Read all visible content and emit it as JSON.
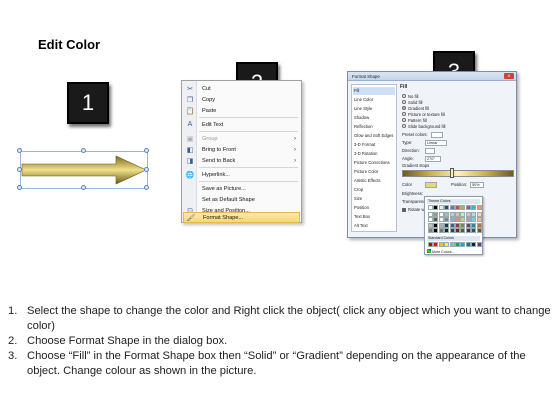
{
  "page": {
    "title": "Edit Color"
  },
  "badges": [
    "1",
    "2",
    "3"
  ],
  "context_menu": {
    "items": [
      {
        "label": "Cut",
        "icon": "scissors-icon",
        "disabled": false,
        "submenu": false,
        "highlight": false
      },
      {
        "label": "Copy",
        "icon": "copy-icon",
        "disabled": false,
        "submenu": false,
        "highlight": false
      },
      {
        "label": "Paste",
        "icon": "paste-icon",
        "disabled": false,
        "submenu": false,
        "highlight": false
      },
      {
        "label": "Edit Text",
        "icon": "edit-text-icon",
        "disabled": false,
        "submenu": false,
        "highlight": false
      },
      {
        "label": "Group",
        "icon": "group-icon",
        "disabled": true,
        "submenu": true,
        "highlight": false
      },
      {
        "label": "Bring to Front",
        "icon": "bring-front-icon",
        "disabled": false,
        "submenu": true,
        "highlight": false
      },
      {
        "label": "Send to Back",
        "icon": "send-back-icon",
        "disabled": false,
        "submenu": true,
        "highlight": false
      },
      {
        "label": "Hyperlink...",
        "icon": "hyperlink-icon",
        "disabled": false,
        "submenu": false,
        "highlight": false
      },
      {
        "label": "Save as Picture...",
        "icon": "",
        "disabled": false,
        "submenu": false,
        "highlight": false
      },
      {
        "label": "Set as Default Shape",
        "icon": "",
        "disabled": false,
        "submenu": false,
        "highlight": false
      },
      {
        "label": "Size and Position...",
        "icon": "size-position-icon",
        "disabled": false,
        "submenu": false,
        "highlight": false
      },
      {
        "label": "Format Shape...",
        "icon": "format-shape-icon",
        "disabled": false,
        "submenu": false,
        "highlight": true
      }
    ]
  },
  "dialog": {
    "title": "Format Shape",
    "close_label": "x",
    "sidebar": [
      "Fill",
      "Line Color",
      "Line Style",
      "Shadow",
      "Reflection",
      "Glow and Soft Edges",
      "3-D Format",
      "3-D Rotation",
      "Picture Corrections",
      "Picture Color",
      "Artistic Effects",
      "Crop",
      "Size",
      "Position",
      "Text Box",
      "Alt Text"
    ],
    "selected_sidebar": "Fill",
    "fill_heading": "Fill",
    "fill_options": [
      {
        "label": "No fill",
        "on": false
      },
      {
        "label": "Solid fill",
        "on": false
      },
      {
        "label": "Gradient fill",
        "on": true
      },
      {
        "label": "Picture or texture fill",
        "on": false
      },
      {
        "label": "Pattern fill",
        "on": false
      },
      {
        "label": "Slide background fill",
        "on": false
      }
    ],
    "fields": {
      "preset_colors": "Preset colors:",
      "type_label": "Type:",
      "type_value": "Linear",
      "direction_label": "Direction:",
      "angle_label": "Angle:",
      "angle_value": "270°",
      "gradient_stops": "Gradient stops",
      "color_label": "Color",
      "position_label": "Position:",
      "position_value": "50%",
      "brightness_label": "Brightness:",
      "transparency_label": "Transparency:",
      "rotate_label": "Rotate with shape"
    }
  },
  "palette": {
    "theme_label": "Theme Colors",
    "standard_label": "Standard Colors",
    "more_label": "More Colors...",
    "theme_top": [
      "#ffffff",
      "#000000",
      "#eeece1",
      "#1f497d",
      "#4f81bd",
      "#c0504d",
      "#9bbb59",
      "#8064a2",
      "#4bacc6",
      "#f79646"
    ],
    "standard": [
      "#c00000",
      "#ff0000",
      "#ffc000",
      "#ffff00",
      "#92d050",
      "#00b050",
      "#00b0f0",
      "#0070c0",
      "#002060",
      "#7030a0"
    ]
  },
  "instructions": [
    {
      "num": "1.",
      "text": "Select the shape to change the color and Right click the object( click any object which you want to change color)"
    },
    {
      "num": "2.",
      "text": "Choose Format Shape in the dialog box."
    },
    {
      "num": "3.",
      "text": "Choose “Fill” in the Format Shape box then “Solid” or “Gradient” depending on the appearance of the object. Change colour as shown in the picture."
    }
  ],
  "colors": {
    "arrow_fill": "#c8b54a",
    "arrow_dark": "#7a6a1c",
    "highlight": "#f7d86f",
    "badge": "#1a1a1a"
  }
}
